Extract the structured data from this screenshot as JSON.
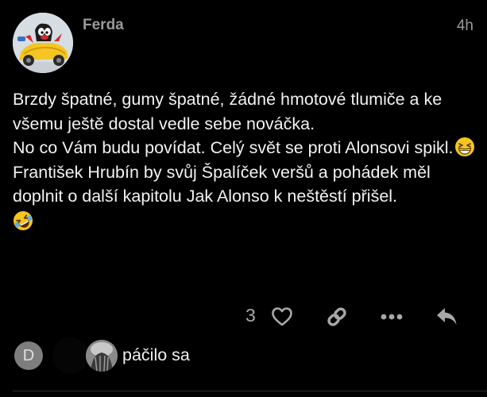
{
  "post": {
    "author": "Ferda",
    "time": "4h",
    "body": {
      "line1": "Brzdy špatné, gumy špatné, žádné hmotové tlumiče a ke všemu ještě dostal vedle sebe nováčka.",
      "line2": "No co Vám budu povídat. Celý svět se proti Alonsovi spikl.",
      "line3": "František Hrubín by svůj Špalíček veršů a pohádek měl doplnit o další kapitolu Jak Alonso k neštěstí přišel."
    }
  },
  "actions": {
    "like_count": "3",
    "icons": [
      "heart-icon",
      "link-icon",
      "more-icon",
      "reply-icon"
    ]
  },
  "likers": {
    "first_initial": "D",
    "text": "páčilo sa"
  },
  "colors": {
    "background": "#000000",
    "text": "#f2f2f2",
    "muted": "#9a9a9a",
    "icon": "#a8a8a8",
    "emoji": "#f7c51f"
  }
}
